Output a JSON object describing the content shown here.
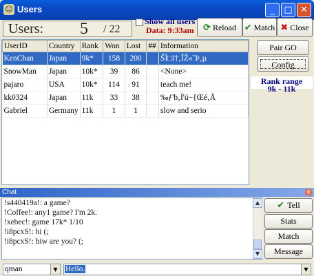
{
  "window": {
    "title": "Users"
  },
  "header": {
    "users_label": "Users:",
    "users_shown": "5",
    "users_total": "/ 22",
    "show_all_label": "Show all users",
    "data_time": "Data: 9:33am",
    "reload_label": "Reload",
    "match_label": "Match",
    "close_label": "Close"
  },
  "table": {
    "columns": [
      "UserID",
      "Country",
      "Rank",
      "Won",
      "Lost",
      "##",
      "Information"
    ],
    "rows": [
      {
        "user": "KenChan",
        "country": "Japan",
        "rank": "9k*",
        "won": "158",
        "lost": "200",
        "flag": "",
        "info": "ŠÏ□í†‚ÎŽ«˜Þ‚µ"
      },
      {
        "user": "SnowMan",
        "country": "Japan",
        "rank": "10k*",
        "won": "39",
        "lost": "86",
        "flag": "",
        "info": "<None>"
      },
      {
        "user": "pajaro",
        "country": "USA",
        "rank": "10k*",
        "won": "114",
        "lost": "91",
        "flag": "",
        "info": "teach me!"
      },
      {
        "user": "kk0324",
        "country": "Japan",
        "rank": "11k",
        "won": "33",
        "lost": "38",
        "flag": "",
        "info": "‰ƒ'b‚Í'ú−{Œé‚Å"
      },
      {
        "user": "Gabriel",
        "country": "Germany",
        "rank": "11k",
        "won": "1",
        "lost": "1",
        "flag": "",
        "info": "slow and serio"
      }
    ]
  },
  "side": {
    "pair_go_label": "Pair GO",
    "config_label": "Config",
    "rank_range_title": "Rank range",
    "rank_range_value": "9k - 11k"
  },
  "chat": {
    "title": "Chat",
    "lines": [
      "!s440419a!: a game?",
      "!Coffee!: any1 game? I'm 2k.",
      "!xebec!: game 17k* 1/10",
      "!i8pcxS!: hi (;",
      "!i8pcxS!: hiw are you? (;"
    ],
    "tell_label": "Tell",
    "stats_label": "Stats",
    "match_label": "Match",
    "message_label": "Message",
    "target_user": "qman",
    "input_value": "Hello."
  },
  "colors": {
    "titlebar": "#0A5EDB",
    "selection": "#316AC5",
    "accent_text": "#000080",
    "time_text": "#b00000"
  }
}
